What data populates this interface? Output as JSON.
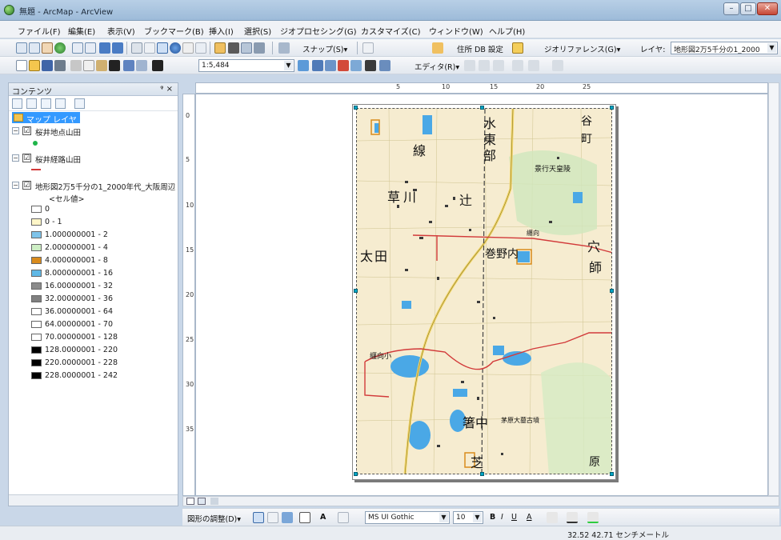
{
  "window": {
    "title": "無題 - ArcMap - ArcView",
    "min": "–",
    "max": "□",
    "close": "✕"
  },
  "menu": [
    "ファイル(F)",
    "編集(E)",
    "表示(V)",
    "ブックマーク(B)",
    "挿入(I)",
    "選択(S)",
    "ジオプロセシング(G)",
    "カスタマイズ(C)",
    "ウィンドウ(W)",
    "ヘルプ(H)"
  ],
  "toolbar1": {
    "snap": "スナップ(S)▾",
    "address": "住所 DB 設定",
    "georef": "ジオリファレンス(G)▾",
    "layer": "レイヤ:",
    "layer_value": "地形図2万5千分の1_2000"
  },
  "toolbar2": {
    "scale": "1:5,484",
    "editor": "エディタ(R)▾"
  },
  "toc": {
    "title": "コンテンツ",
    "pin": "ᵠ ×",
    "root": "マップ レイヤ",
    "layers": [
      {
        "name": "桜井地点山田",
        "checked": "☑",
        "expand": "−"
      },
      {
        "name": "桜井経路山田",
        "checked": "☑",
        "expand": "−"
      },
      {
        "name": "地形図2万5千分の1_2000年代_大阪周辺",
        "checked": "☑",
        "expand": "−"
      }
    ],
    "cell_value": "<セル値>",
    "legend": [
      {
        "label": "0",
        "color": "#ffffff"
      },
      {
        "label": "0 - 1",
        "color": "#fff6c8"
      },
      {
        "label": "1.000000001 - 2",
        "color": "#7fc4ea"
      },
      {
        "label": "2.000000001 - 4",
        "color": "#cdeec4"
      },
      {
        "label": "4.000000001 - 8",
        "color": "#d98b1c"
      },
      {
        "label": "8.000000001 - 16",
        "color": "#5fb8e6"
      },
      {
        "label": "16.00000001 - 32",
        "color": "#8b8b8b"
      },
      {
        "label": "32.00000001 - 36",
        "color": "#808080"
      },
      {
        "label": "36.00000001 - 64",
        "color": "#ffffff"
      },
      {
        "label": "64.00000001 - 70",
        "color": "#ffffff"
      },
      {
        "label": "70.00000001 - 128",
        "color": "#ffffff"
      },
      {
        "label": "128.0000001 - 220",
        "color": "#000000"
      },
      {
        "label": "220.0000001 - 228",
        "color": "#000000"
      },
      {
        "label": "228.0000001 - 242",
        "color": "#000000"
      }
    ]
  },
  "ruler": {
    "top": [
      "5",
      "10",
      "15",
      "20",
      "25"
    ],
    "left": [
      "0",
      "5",
      "10",
      "15",
      "20",
      "25",
      "30",
      "35"
    ]
  },
  "map_labels": [
    "水",
    "東",
    "部",
    "谷",
    "町",
    "線",
    "景行天皇陵",
    "草",
    "川",
    "辻",
    "纒向",
    "穴",
    "師",
    "太",
    "田",
    "巻野内",
    "箸中",
    "纒向小",
    "茅原大墓古墳",
    "芝",
    "原"
  ],
  "drawing": {
    "drawing_menu": "図形の調整(D)▾",
    "font": "MS UI Gothic",
    "size": "10",
    "bold": "B",
    "italic": "I",
    "underline": "U",
    "font_color": "A"
  },
  "status": {
    "coords": "32.52  42.71 センチメートル"
  },
  "colors": {
    "selection": "#3399ff",
    "route": "#d23a3a",
    "water": "#4aa8e6",
    "buildings": "#3a3a3a"
  }
}
